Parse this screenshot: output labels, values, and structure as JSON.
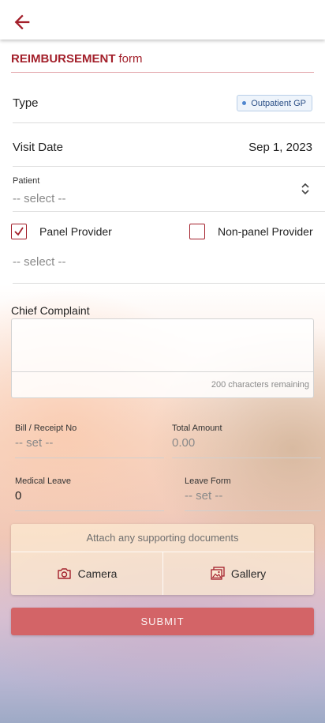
{
  "header": {
    "title_strong": "REIMBURSEMENT",
    "title_light": "form"
  },
  "type_row": {
    "label": "Type",
    "badge": "Outpatient GP"
  },
  "visit_date_row": {
    "label": "Visit Date",
    "value": "Sep 1, 2023"
  },
  "patient": {
    "label": "Patient",
    "placeholder": "-- select --"
  },
  "provider": {
    "panel_label": "Panel Provider",
    "panel_checked": true,
    "nonpanel_label": "Non-panel Provider",
    "nonpanel_checked": false,
    "select_placeholder": "-- select --"
  },
  "chief_complaint": {
    "label": "Chief Complaint",
    "remaining": "200 characters remaining"
  },
  "bill": {
    "label": "Bill / Receipt No",
    "placeholder": "-- set --"
  },
  "total": {
    "label": "Total Amount",
    "placeholder": "0.00"
  },
  "medical_leave": {
    "label": "Medical Leave",
    "value": "0"
  },
  "leave_form": {
    "label": "Leave Form",
    "placeholder": "-- set --"
  },
  "attach": {
    "title": "Attach any supporting documents",
    "camera_label": "Camera",
    "gallery_label": "Gallery"
  },
  "submit_label": "SUBMIT",
  "colors": {
    "brand": "#a3202b",
    "submit": "#d36467",
    "badge_text": "#2b4f86"
  },
  "icons": {
    "back": "arrow-left-icon",
    "sort": "unfold-icon",
    "check": "check-icon",
    "camera": "camera-icon",
    "gallery": "gallery-icon"
  }
}
